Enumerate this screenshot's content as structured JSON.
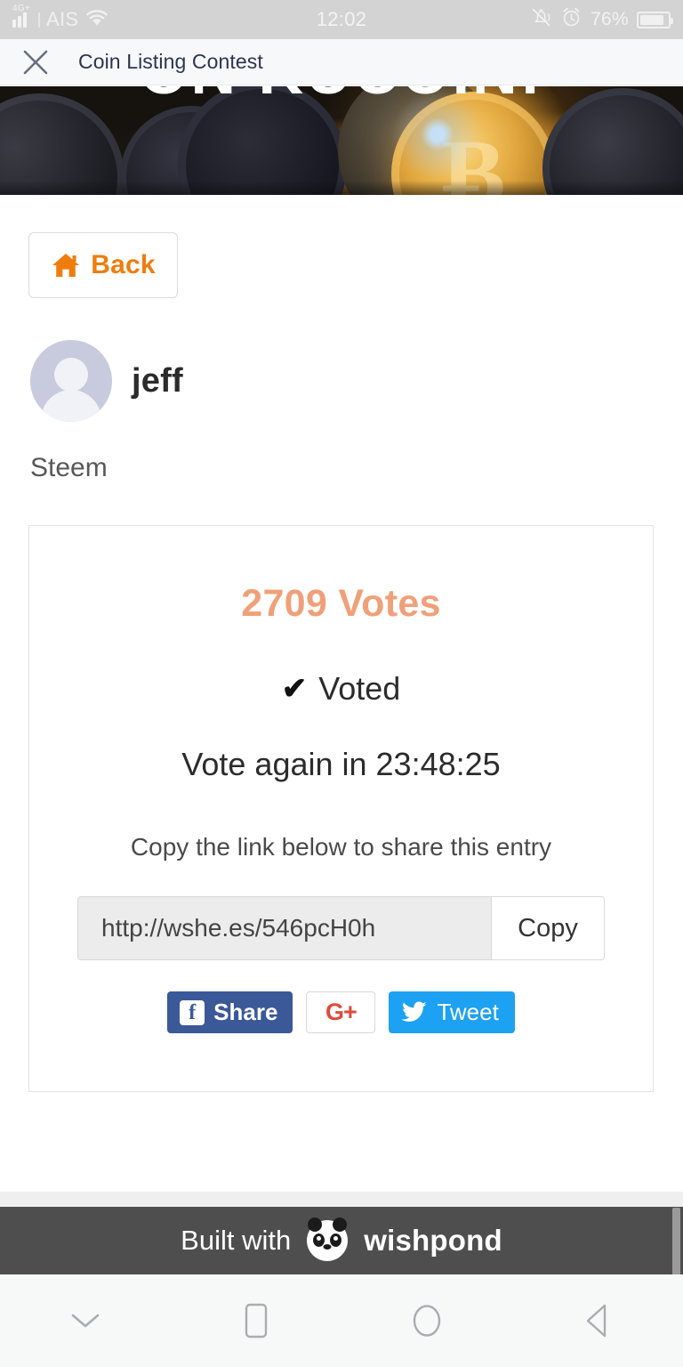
{
  "status_bar": {
    "network_type": "4G+",
    "carrier": "AIS",
    "wifi_icon": "wifi-icon",
    "time": "12:02",
    "vibrate_icon": "vibrate-off-icon",
    "alarm_icon": "alarm-clock-icon",
    "battery_percent": "76%",
    "battery_icon": "battery-icon"
  },
  "title_bar": {
    "close_icon": "close-icon",
    "title": "Coin Listing Contest"
  },
  "hero": {
    "headline": "ON KUCOIN!",
    "bitcoin_glyph": "Ƀ",
    "alt": "pile of cryptocurrency coins"
  },
  "page": {
    "back_button": {
      "label": "Back",
      "icon": "home-icon"
    },
    "entry": {
      "avatar_icon": "avatar-placeholder-icon",
      "username": "jeff",
      "coin_name": "Steem"
    },
    "vote_card": {
      "votes_label": "2709 Votes",
      "vote_count": 2709,
      "voted_label": "Voted",
      "check_glyph": "✔",
      "vote_again_label": "Vote again in 23:48:25",
      "countdown": "23:48:25",
      "share_hint": "Copy the link below to share this entry",
      "share_url": "http://wshe.es/546pcH0h",
      "copy_button": "Copy",
      "social": {
        "facebook_label": "Share",
        "facebook_icon": "facebook-icon",
        "facebook_mark": "f",
        "google_plus_label": "G+",
        "google_plus_icon": "google-plus-icon",
        "twitter_label": "Tweet",
        "twitter_icon": "twitter-bird-icon"
      }
    }
  },
  "footer": {
    "built_with": "Built with",
    "brand": "wishpond",
    "logo_icon": "panda-logo-icon"
  },
  "nav_bar": {
    "hide_keyboard_icon": "chevron-down-icon",
    "recents_icon": "square-icon",
    "home_icon": "circle-icon",
    "back_icon": "triangle-left-icon"
  },
  "colors": {
    "accent_orange": "#ef7d0e",
    "votes_salmon": "#f0a079",
    "facebook_blue": "#3b5998",
    "twitter_blue": "#1da1f2",
    "google_red": "#dd4b39",
    "footer_gray": "#4e4e4e",
    "status_bar_gray": "#d3d3d3",
    "title_navy": "#2b3550"
  }
}
